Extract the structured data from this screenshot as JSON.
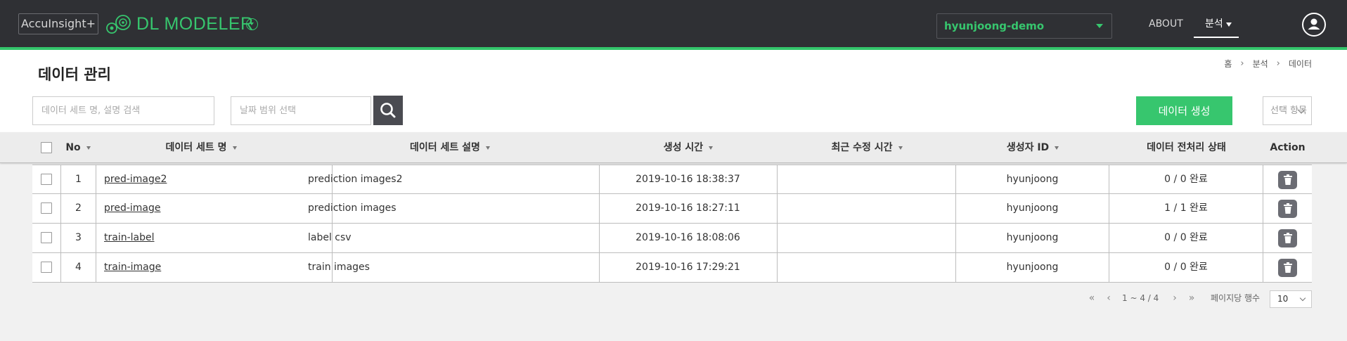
{
  "header": {
    "brand": "AccuInsight+",
    "product": "DL MODELER",
    "project": "hyunjoong-demo",
    "nav": {
      "about": "ABOUT",
      "analysis": "분석"
    }
  },
  "page": {
    "title": "데이터 관리",
    "breadcrumb": [
      "홈",
      "분석",
      "데이터"
    ]
  },
  "toolbar": {
    "search_placeholder": "데이터 세트 명, 설명 검색",
    "date_placeholder": "날짜 범위 선택",
    "create_label": "데이터 생성",
    "select_items_label": "선택 항목"
  },
  "table": {
    "columns": [
      "No",
      "데이터 세트 명",
      "데이터 세트 설명",
      "생성 시간",
      "최근 수정 시간",
      "생성자 ID",
      "데이터 전처리 상태",
      "Action"
    ],
    "rows": [
      {
        "no": "1",
        "name": "pred-image2",
        "desc": "prediction images2",
        "created": "2019-10-16 18:38:37",
        "modified": "",
        "creator": "hyunjoong",
        "status": "0 / 0 완료"
      },
      {
        "no": "2",
        "name": "pred-image",
        "desc": "prediction images",
        "created": "2019-10-16 18:27:11",
        "modified": "",
        "creator": "hyunjoong",
        "status": "1 / 1 완료"
      },
      {
        "no": "3",
        "name": "train-label",
        "desc": "label csv",
        "created": "2019-10-16 18:08:06",
        "modified": "",
        "creator": "hyunjoong",
        "status": "0 / 0 완료"
      },
      {
        "no": "4",
        "name": "train-image",
        "desc": "train images",
        "created": "2019-10-16 17:29:21",
        "modified": "",
        "creator": "hyunjoong",
        "status": "0 / 0 완료"
      }
    ]
  },
  "pagination": {
    "range": "1 ~ 4 / 4",
    "rows_per_page_label": "페이지당 행수",
    "rows_per_page": "10"
  },
  "colors": {
    "accent": "#37c66e",
    "topbar": "#2f3034"
  }
}
